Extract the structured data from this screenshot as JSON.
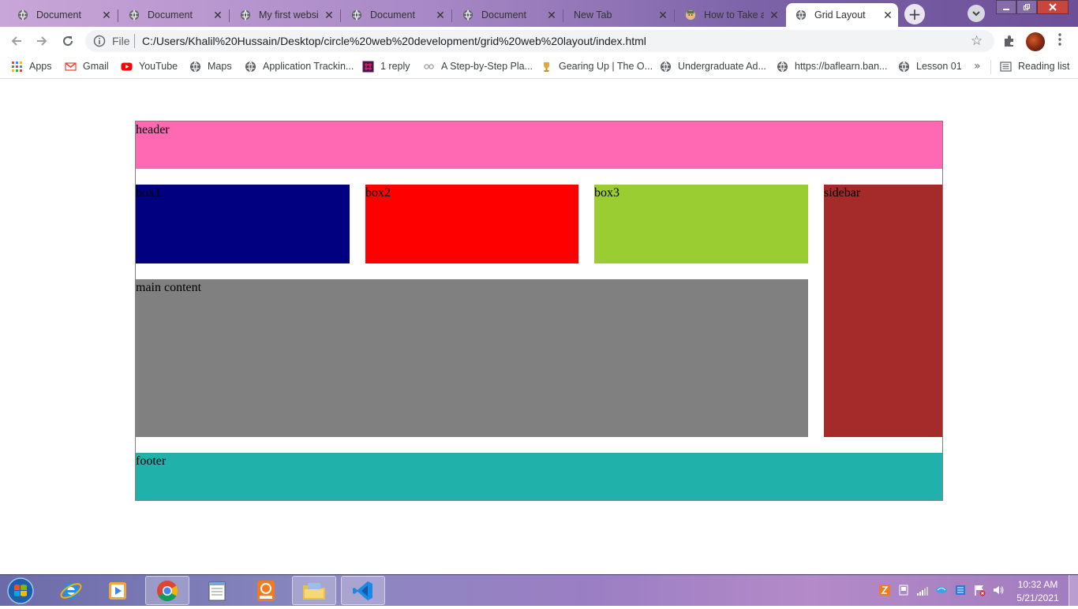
{
  "browser": {
    "tabs": [
      {
        "title": "Document",
        "active": false
      },
      {
        "title": "Document",
        "active": false
      },
      {
        "title": "My first website",
        "active": false
      },
      {
        "title": "Document",
        "active": false
      },
      {
        "title": "Document",
        "active": false
      },
      {
        "title": "New Tab",
        "active": false
      },
      {
        "title": "How to Take a",
        "active": false
      },
      {
        "title": "Grid Layout",
        "active": true
      }
    ],
    "close_glyph": "✕",
    "new_tab_glyph": "+",
    "omnibox": {
      "scheme_label": "File",
      "url": "C:/Users/Khalil%20Hussain/Desktop/circle%20web%20development/grid%20web%20layout/index.html"
    },
    "bookmarks": [
      {
        "label": "Apps",
        "icon": "apps-grid-icon"
      },
      {
        "label": "Gmail",
        "icon": "gmail-icon"
      },
      {
        "label": "YouTube",
        "icon": "youtube-icon"
      },
      {
        "label": "Maps",
        "icon": "globe-icon"
      },
      {
        "label": "Application Trackin...",
        "icon": "globe-icon"
      },
      {
        "label": "1 reply",
        "icon": "slack-icon"
      },
      {
        "label": "A Step-by-Step Pla...",
        "icon": "link-icon"
      },
      {
        "label": "Gearing Up | The O...",
        "icon": "trophy-icon"
      },
      {
        "label": "Undergraduate Ad...",
        "icon": "globe-icon"
      },
      {
        "label": "https://baflearn.ban...",
        "icon": "globe-icon"
      },
      {
        "label": "Lesson 01",
        "icon": "globe-icon"
      }
    ],
    "bookmarks_overflow": "»",
    "reading_list": "Reading list"
  },
  "page": {
    "header": "header",
    "box1": "box1",
    "box2": "box2",
    "box3": "box3",
    "sidebar": "sidebar",
    "main": "main content",
    "footer": "footer"
  },
  "colors": {
    "header": "#ff69b4",
    "box1": "#000080",
    "box2": "#ff0000",
    "box3": "#9acd32",
    "sidebar": "#a52a2a",
    "main": "#808080",
    "footer": "#20b2aa"
  },
  "taskbar": {
    "apps": [
      "start-orb-icon",
      "internet-explorer-icon",
      "media-player-icon",
      "chrome-icon",
      "notepad-icon",
      "pdf-reader-icon",
      "file-explorer-icon",
      "vscode-icon"
    ],
    "clock_time": "10:32 AM",
    "clock_date": "5/21/2021"
  }
}
